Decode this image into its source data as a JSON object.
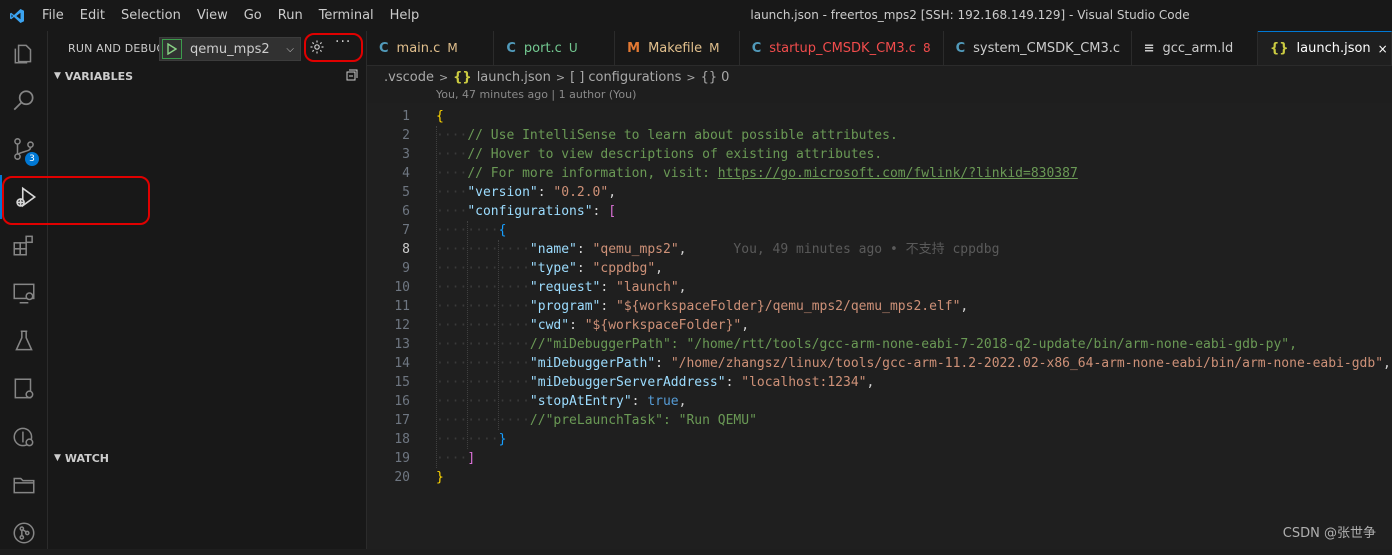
{
  "titlebar": {
    "menu": [
      "File",
      "Edit",
      "Selection",
      "View",
      "Go",
      "Run",
      "Terminal",
      "Help"
    ],
    "window_title": "launch.json - freertos_mps2 [SSH: 192.168.149.129] - Visual Studio Code"
  },
  "activity": {
    "scm_badge": "3",
    "items": [
      "explorer-icon",
      "search-icon",
      "source-control-icon",
      "run-debug-icon",
      "extensions-icon",
      "remote-explorer-icon",
      "testing-icon",
      "docker-icon",
      "git-graph-icon",
      "folder-icon",
      "git-icon"
    ]
  },
  "sidebar": {
    "title": "RUN AND DEBUG",
    "config_name": "qemu_mps2",
    "more": "···",
    "variables": "VARIABLES",
    "watch": "WATCH"
  },
  "tabs": [
    {
      "icon": "C",
      "label": "main.c",
      "status": "M",
      "icon_color": "#519aba",
      "label_color": "#e2c08d",
      "status_color": "#e2c08d"
    },
    {
      "icon": "C",
      "label": "port.c",
      "status": "U",
      "icon_color": "#519aba",
      "label_color": "#73c991",
      "status_color": "#73c991"
    },
    {
      "icon": "M",
      "label": "Makefile",
      "status": "M",
      "icon_color": "#e37933",
      "label_color": "#e2c08d",
      "status_color": "#e2c08d"
    },
    {
      "icon": "C",
      "label": "startup_CMSDK_CM3.c",
      "status": "8",
      "icon_color": "#519aba",
      "label_color": "#f14c4c",
      "status_color": "#f14c4c"
    },
    {
      "icon": "C",
      "label": "system_CMSDK_CM3.c",
      "status": "",
      "icon_color": "#519aba",
      "label_color": "#cccccc",
      "status_color": "#cccccc"
    },
    {
      "icon": "≡",
      "label": "gcc_arm.ld",
      "status": "",
      "icon_color": "#cccccc",
      "label_color": "#cccccc",
      "status_color": "#cccccc"
    },
    {
      "icon": "{}",
      "label": "launch.json",
      "status": "×",
      "icon_color": "#cbcb41",
      "label_color": "#ffffff",
      "status_color": "#ffffff"
    }
  ],
  "breadcrumb": {
    "folder": ".vscode",
    "file": "launch.json",
    "file_icon": "{}",
    "node1_icon": "[ ]",
    "node1": "configurations",
    "node2_icon": "{}",
    "node2": "0"
  },
  "blame_top": "You, 47 minutes ago | 1 author (You)",
  "editor": {
    "current_line": 8,
    "lines": [
      {
        "n": "1",
        "indent": 0,
        "parts": [
          {
            "t": "{",
            "c": "c-brace"
          }
        ]
      },
      {
        "n": "2",
        "indent": 1,
        "parts": [
          {
            "t": "// Use IntelliSense to learn about possible attributes.",
            "c": "c-com"
          }
        ]
      },
      {
        "n": "3",
        "indent": 1,
        "parts": [
          {
            "t": "// Hover to view descriptions of existing attributes.",
            "c": "c-com"
          }
        ]
      },
      {
        "n": "4",
        "indent": 1,
        "parts": [
          {
            "t": "// For more information, visit: ",
            "c": "c-com"
          },
          {
            "t": "https://go.microsoft.com/fwlink/?linkid=830387",
            "c": "c-link"
          }
        ]
      },
      {
        "n": "5",
        "indent": 1,
        "parts": [
          {
            "t": "\"version\"",
            "c": "c-key"
          },
          {
            "t": ": ",
            "c": "c-plain"
          },
          {
            "t": "\"0.2.0\"",
            "c": "c-str"
          },
          {
            "t": ",",
            "c": "c-plain"
          }
        ]
      },
      {
        "n": "6",
        "indent": 1,
        "parts": [
          {
            "t": "\"configurations\"",
            "c": "c-key"
          },
          {
            "t": ": ",
            "c": "c-plain"
          },
          {
            "t": "[",
            "c": "c-bracket"
          }
        ]
      },
      {
        "n": "7",
        "indent": 2,
        "parts": [
          {
            "t": "{",
            "c": "c-brace2"
          }
        ]
      },
      {
        "n": "8",
        "indent": 3,
        "parts": [
          {
            "t": "\"name\"",
            "c": "c-key"
          },
          {
            "t": ": ",
            "c": "c-plain"
          },
          {
            "t": "\"qemu_mps2\"",
            "c": "c-str"
          },
          {
            "t": ",",
            "c": "c-plain"
          },
          {
            "t": "      You, 49 minutes ago • 不支持 cppdbg",
            "c": "c-ghost"
          }
        ]
      },
      {
        "n": "9",
        "indent": 3,
        "parts": [
          {
            "t": "\"type\"",
            "c": "c-key"
          },
          {
            "t": ": ",
            "c": "c-plain"
          },
          {
            "t": "\"cppdbg\"",
            "c": "c-str"
          },
          {
            "t": ",",
            "c": "c-plain"
          }
        ]
      },
      {
        "n": "10",
        "indent": 3,
        "parts": [
          {
            "t": "\"request\"",
            "c": "c-key"
          },
          {
            "t": ": ",
            "c": "c-plain"
          },
          {
            "t": "\"launch\"",
            "c": "c-str"
          },
          {
            "t": ",",
            "c": "c-plain"
          }
        ]
      },
      {
        "n": "11",
        "indent": 3,
        "parts": [
          {
            "t": "\"program\"",
            "c": "c-key"
          },
          {
            "t": ": ",
            "c": "c-plain"
          },
          {
            "t": "\"${workspaceFolder}/qemu_mps2/qemu_mps2.elf\"",
            "c": "c-str"
          },
          {
            "t": ",",
            "c": "c-plain"
          }
        ]
      },
      {
        "n": "12",
        "indent": 3,
        "parts": [
          {
            "t": "\"cwd\"",
            "c": "c-key"
          },
          {
            "t": ": ",
            "c": "c-plain"
          },
          {
            "t": "\"${workspaceFolder}\"",
            "c": "c-str"
          },
          {
            "t": ",",
            "c": "c-plain"
          }
        ]
      },
      {
        "n": "13",
        "indent": 3,
        "parts": [
          {
            "t": "//\"miDebuggerPath\": \"/home/rtt/tools/gcc-arm-none-eabi-7-2018-q2-update/bin/arm-none-eabi-gdb-py\",",
            "c": "c-com"
          }
        ]
      },
      {
        "n": "14",
        "indent": 3,
        "parts": [
          {
            "t": "\"miDebuggerPath\"",
            "c": "c-key"
          },
          {
            "t": ": ",
            "c": "c-plain"
          },
          {
            "t": "\"/home/zhangsz/linux/tools/gcc-arm-11.2-2022.02-x86_64-arm-none-eabi/bin/arm-none-eabi-gdb\"",
            "c": "c-str"
          },
          {
            "t": ",",
            "c": "c-plain"
          }
        ]
      },
      {
        "n": "15",
        "indent": 3,
        "parts": [
          {
            "t": "\"miDebuggerServerAddress\"",
            "c": "c-key"
          },
          {
            "t": ": ",
            "c": "c-plain"
          },
          {
            "t": "\"localhost:1234\"",
            "c": "c-str"
          },
          {
            "t": ",",
            "c": "c-plain"
          }
        ]
      },
      {
        "n": "16",
        "indent": 3,
        "parts": [
          {
            "t": "\"stopAtEntry\"",
            "c": "c-key"
          },
          {
            "t": ": ",
            "c": "c-plain"
          },
          {
            "t": "true",
            "c": "c-bool"
          },
          {
            "t": ",",
            "c": "c-plain"
          }
        ]
      },
      {
        "n": "17",
        "indent": 3,
        "parts": [
          {
            "t": "//\"preLaunchTask\": \"Run QEMU\"",
            "c": "c-com"
          }
        ]
      },
      {
        "n": "18",
        "indent": 2,
        "parts": [
          {
            "t": "}",
            "c": "c-brace2"
          }
        ]
      },
      {
        "n": "19",
        "indent": 1,
        "parts": [
          {
            "t": "]",
            "c": "c-bracket"
          }
        ]
      },
      {
        "n": "20",
        "indent": 0,
        "parts": [
          {
            "t": "}",
            "c": "c-brace"
          }
        ]
      }
    ]
  },
  "watermark": "CSDN @张世争",
  "colors": {
    "accent": "#0078d4",
    "annotation": "#e00000"
  }
}
